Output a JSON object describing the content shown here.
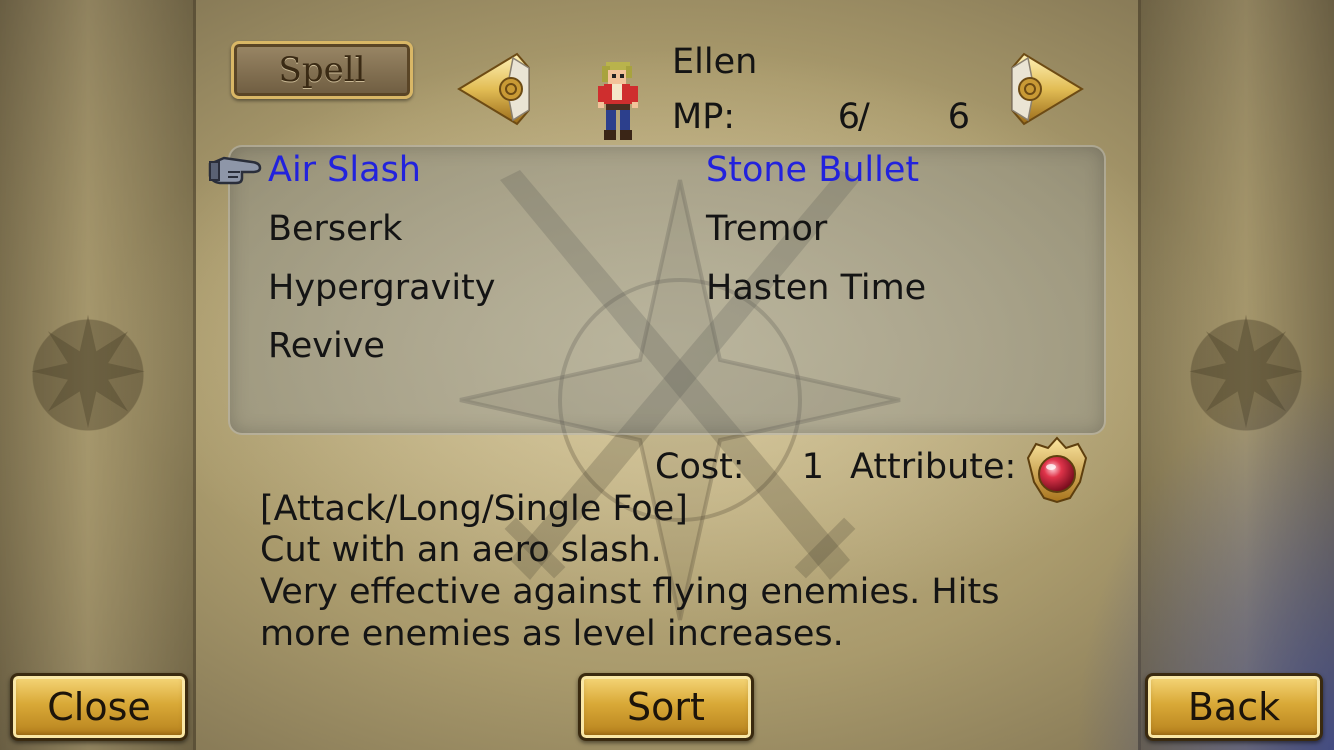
{
  "header": {
    "tab_label": "Spell",
    "character_name": "Ellen",
    "mp_label": "MP:",
    "mp_current": "6",
    "mp_separator": "/",
    "mp_max": "6"
  },
  "spells": [
    {
      "label": "Air Slash",
      "selected": true
    },
    {
      "label": "Stone Bullet",
      "selected": true
    },
    {
      "label": "Berserk",
      "selected": false
    },
    {
      "label": "Tremor",
      "selected": false
    },
    {
      "label": "Hypergravity",
      "selected": false
    },
    {
      "label": "Hasten Time",
      "selected": false
    },
    {
      "label": "Revive",
      "selected": false
    }
  ],
  "detail": {
    "cost_label": "Cost:",
    "cost_value": "1",
    "attribute_label": "Attribute:",
    "attribute_icon": "red-orb-icon",
    "lines": [
      "[Attack/Long/Single Foe]",
      "Cut with an aero slash.",
      "Very effective against flying enemies. Hits",
      "more enemies as level increases."
    ]
  },
  "buttons": {
    "close": "Close",
    "sort": "Sort",
    "back": "Back"
  },
  "colors": {
    "selected_text": "#2222dd",
    "normal_text": "#141414",
    "button_gold": "#d9a937"
  }
}
